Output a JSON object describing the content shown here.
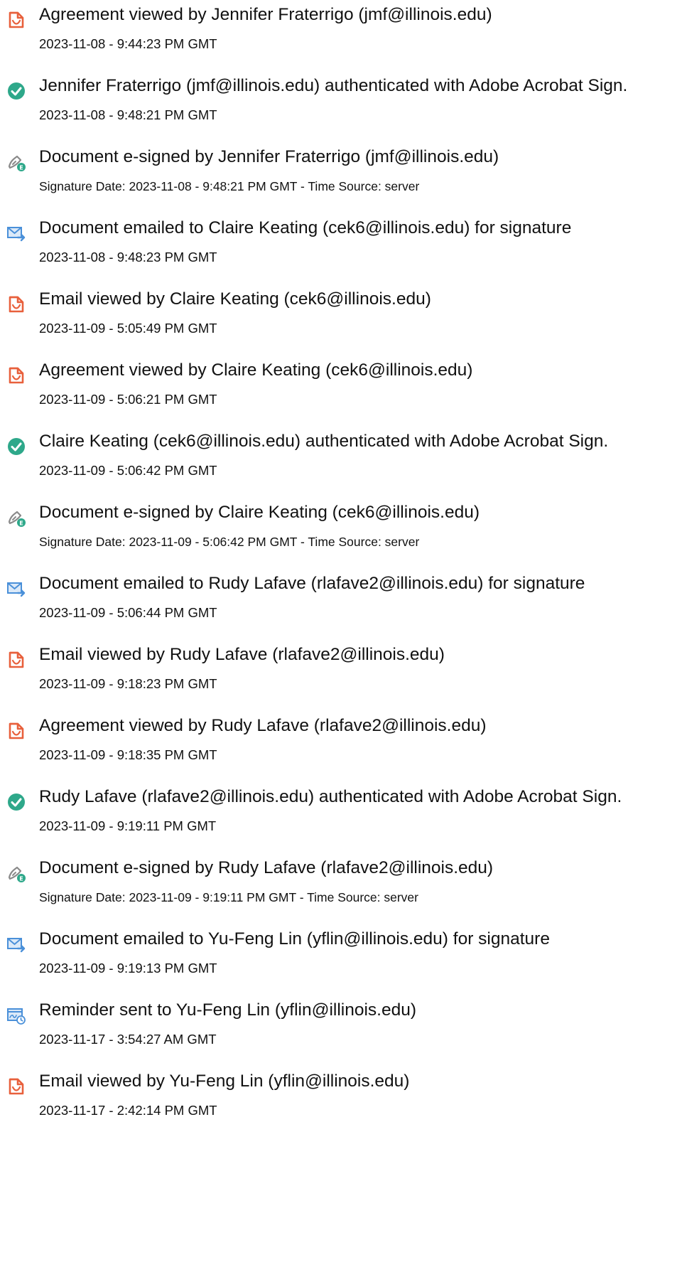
{
  "events": [
    {
      "icon": "document-view-icon",
      "title": "Agreement viewed by Jennifer Fraterrigo (jmf@illinois.edu)",
      "timestamp": "2023-11-08 - 9:44:23 PM GMT"
    },
    {
      "icon": "check-circle-icon",
      "title": "Jennifer Fraterrigo (jmf@illinois.edu) authenticated with Adobe Acrobat Sign.",
      "timestamp": "2023-11-08 - 9:48:21 PM GMT"
    },
    {
      "icon": "esign-pen-icon",
      "title": "Document e-signed by Jennifer Fraterrigo (jmf@illinois.edu)",
      "timestamp": "Signature Date: 2023-11-08 - 9:48:21 PM GMT - Time Source: server"
    },
    {
      "icon": "email-send-icon",
      "title": "Document emailed to Claire Keating (cek6@illinois.edu) for signature",
      "timestamp": "2023-11-08 - 9:48:23 PM GMT"
    },
    {
      "icon": "document-view-icon",
      "title": "Email viewed by Claire Keating (cek6@illinois.edu)",
      "timestamp": "2023-11-09 - 5:05:49 PM GMT"
    },
    {
      "icon": "document-view-icon",
      "title": "Agreement viewed by Claire Keating (cek6@illinois.edu)",
      "timestamp": "2023-11-09 - 5:06:21 PM GMT"
    },
    {
      "icon": "check-circle-icon",
      "title": "Claire Keating (cek6@illinois.edu) authenticated with Adobe Acrobat Sign.",
      "timestamp": "2023-11-09 - 5:06:42 PM GMT"
    },
    {
      "icon": "esign-pen-icon",
      "title": "Document e-signed by Claire Keating (cek6@illinois.edu)",
      "timestamp": "Signature Date: 2023-11-09 - 5:06:42 PM GMT - Time Source: server"
    },
    {
      "icon": "email-send-icon",
      "title": "Document emailed to Rudy Lafave (rlafave2@illinois.edu) for signature",
      "timestamp": "2023-11-09 - 5:06:44 PM GMT"
    },
    {
      "icon": "document-view-icon",
      "title": "Email viewed by Rudy Lafave (rlafave2@illinois.edu)",
      "timestamp": "2023-11-09 - 9:18:23 PM GMT"
    },
    {
      "icon": "document-view-icon",
      "title": "Agreement viewed by Rudy Lafave (rlafave2@illinois.edu)",
      "timestamp": "2023-11-09 - 9:18:35 PM GMT"
    },
    {
      "icon": "check-circle-icon",
      "title": "Rudy Lafave (rlafave2@illinois.edu) authenticated with Adobe Acrobat Sign.",
      "timestamp": "2023-11-09 - 9:19:11 PM GMT"
    },
    {
      "icon": "esign-pen-icon",
      "title": "Document e-signed by Rudy Lafave (rlafave2@illinois.edu)",
      "timestamp": "Signature Date: 2023-11-09 - 9:19:11 PM GMT - Time Source: server"
    },
    {
      "icon": "email-send-icon",
      "title": "Document emailed to Yu-Feng Lin (yflin@illinois.edu) for signature",
      "timestamp": "2023-11-09 - 9:19:13 PM GMT"
    },
    {
      "icon": "reminder-clock-icon",
      "title": "Reminder sent to Yu-Feng Lin (yflin@illinois.edu)",
      "timestamp": "2023-11-17 - 3:54:27 AM GMT"
    },
    {
      "icon": "document-view-icon",
      "title": "Email viewed by Yu-Feng Lin (yflin@illinois.edu)",
      "timestamp": "2023-11-17 - 2:42:14 PM GMT"
    }
  ],
  "colors": {
    "document_view": "#e8603c",
    "check": "#2ea88a",
    "esign_pen": "#8a8a8a",
    "esign_badge": "#2ea88a",
    "email": "#4a90d9",
    "reminder": "#4a90d9"
  }
}
